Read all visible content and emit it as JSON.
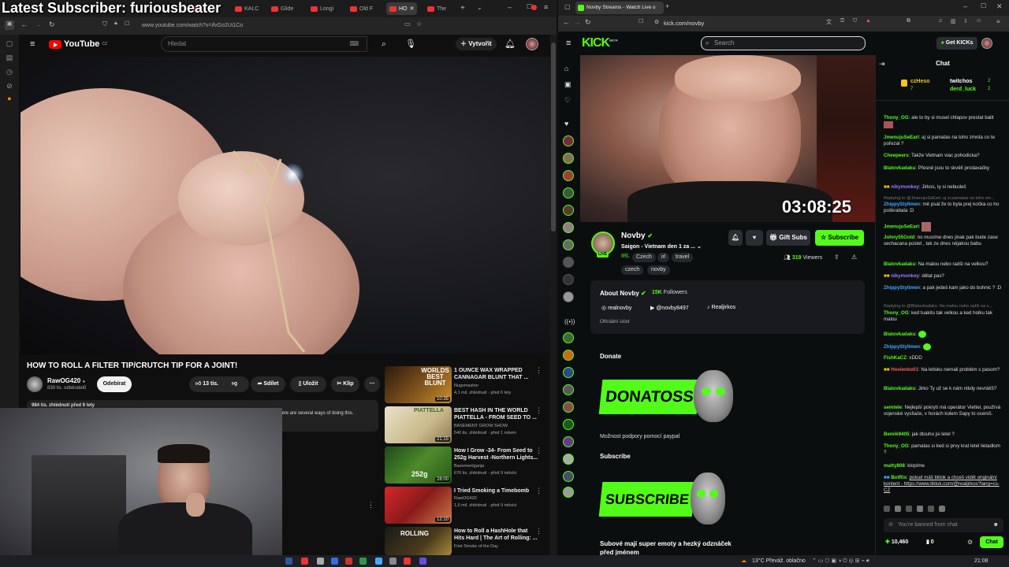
{
  "overlay": {
    "text": "Latest Subscriber: furiousbeater"
  },
  "left_browser": {
    "tabs": [
      {
        "label": "Beaut"
      },
      {
        "label": "KALC"
      },
      {
        "label": "Glide"
      },
      {
        "label": "Longi"
      },
      {
        "label": "Old F"
      },
      {
        "label": "HO"
      },
      {
        "label": "The"
      }
    ],
    "url": "www.youtube.com/watch?v=ifvGo2Ui1Co"
  },
  "youtube": {
    "logo_text": "YouTube",
    "region": "CZ",
    "search_placeholder": "Hledat",
    "create_label": "Vytvořit",
    "video_title": "HOW TO ROLL A FILTER TIP/CRUTCH TIP FOR A JOINT!",
    "channel_name": "RawOG420",
    "subscribers": "839 tis. odběratelů",
    "subscribe_label": "Odebírat",
    "likes": "13 tis.",
    "share_label": "Sdílet",
    "save_label": "Uložit",
    "clip_label": "Klip",
    "description_stats": "984 tis. zhlédnutí  před 9 lety",
    "description_snippet": "here are several ways of doing this.",
    "recommendations": [
      {
        "title": "1 OUNCE WAX WRAPPED CANNAGAR BLUNT THAT ...",
        "channel": "Nugsmasher",
        "meta": "4,1 mil. zhlédnutí · před 6 lety",
        "duration": "10:35",
        "thumb_text": "WORLDS BEST BLUNT"
      },
      {
        "title": "BEST HASH IN THE WORLD PIATTELLA - FROM SEED TO ...",
        "channel": "BASEMENT GROW SHOW",
        "meta": "540 tis. zhlédnutí · před 1 rokem",
        "duration": "21:15",
        "thumb_text": "PIATTELLA"
      },
      {
        "title": "How I Grow -34- From Seed to 252g Harvest -Northern Lights...",
        "channel": "Basementganja",
        "meta": "676 tis. zhlédnutí · před 9 měsíci",
        "duration": "28:00",
        "thumb_text": "252g"
      },
      {
        "title": "I Tried Smoking a Timebomb",
        "channel": "RawOG420",
        "meta": "1,6 mil. zhlédnutí · před 9 měsíci",
        "duration": "12:10",
        "thumb_text": ""
      },
      {
        "title": "How to Roll a HashHole that Hits Hard | The Art of Rolling: ...",
        "channel": "First Smoke of the Day",
        "meta": "",
        "duration": "",
        "thumb_text": "ROLLING"
      }
    ]
  },
  "right_browser": {
    "tab_title": "Novby Streams - Watch Live o",
    "url": "kick.com/novby"
  },
  "kick": {
    "logo": "KICK",
    "logo_badge": "BETA",
    "search_placeholder": "Search",
    "get_kicks_label": "Get KICKs",
    "timer": "03:08:25",
    "streamer": "Novby",
    "live_label": "LIVE",
    "stream_title": "Saigon - Vietnam den 1 za ...",
    "tags": [
      "IRL",
      "Czech",
      "irl",
      "travel",
      "czech",
      "novby"
    ],
    "gift_subs_label": "Gift Subs",
    "subscribe_label": "Subscribe",
    "viewers": "319",
    "viewers_label": "Viewers",
    "about_title": "About Novby",
    "followers_count": "15K",
    "followers_label": "Followers",
    "socials": [
      "realnovby",
      "@novby8497",
      "Realjirkos"
    ],
    "official_account": "Oficiální účet",
    "donate_heading": "Donate",
    "donate_banner": "DONATOSS",
    "donate_caption": "Možnost podpory pomocí paypal",
    "subscribe_heading": "Subscribe",
    "subscribe_banner": "SUBSCRIBE",
    "emote_text": "Subové mají super emoty a hezký odznáček před jménem",
    "accent": "#53fc18"
  },
  "chat": {
    "title": "Chat",
    "leaders": [
      {
        "name": "czHeso",
        "count": "7"
      },
      {
        "name": "twitchos",
        "count": "2"
      },
      {
        "name": "derd_luck",
        "count": "2"
      }
    ],
    "messages": [
      {
        "user": "Thony_OG",
        "text": "ale to by si musel chlapov prestat balit",
        "color": "#53fc18"
      },
      {
        "user": "JmenujuSeEarl",
        "text": "aj si pamatas na toho zmrda co te pořezal ?",
        "color": "#53fc18"
      },
      {
        "user": "Cheepeers",
        "text": "Takže Vietnam viac pohodicka?",
        "color": "#53fc18"
      },
      {
        "user": "Blatovkadaku",
        "text": "Přesně jsou to skvělí prodavačky",
        "color": "#53fc18"
      },
      {
        "user": "nikymonkey",
        "text": "Jirkos, ty si nebudeš",
        "color": "#9b7bff"
      },
      {
        "user": "ZhippyStyllmen",
        "text": "mě psal že to byla prej kočka co ho poškrabala :D",
        "color": "#3fa9ff"
      },
      {
        "user": "JmenujuSeEarl",
        "text": "",
        "color": "#53fc18"
      },
      {
        "user": "Johny55Gold",
        "text": "no musíme dnes jinak pak bude zase sechacana postel , tak ze dnes nějakou babu",
        "color": "#53fc18"
      },
      {
        "user": "Blatovkadaku",
        "text": "Na malou nebo radši na velkou?",
        "color": "#53fc18"
      },
      {
        "user": "nikymonkey",
        "text": "dělat pas?",
        "color": "#9b7bff"
      },
      {
        "user": "ZhippyStyllmen",
        "text": "a pak jedeš kam jako do bohnic ? :D",
        "color": "#3fa9ff"
      },
      {
        "user": "Thony_OG",
        "text": "ked tuakitu tak velkou a ked holku tak malou",
        "color": "#53fc18"
      },
      {
        "user": "Blatovkadaku",
        "text": "",
        "color": "#53fc18"
      },
      {
        "user": "ZhippyStyllmen",
        "text": "",
        "color": "#3fa9ff"
      },
      {
        "user": "FishKaCZ",
        "text": "xDDD",
        "color": "#53fc18"
      },
      {
        "user": "Hovienko01",
        "text": "Na letisku nemali problém s pasom?",
        "color": "#ff5a5a"
      },
      {
        "user": "Blatovkadaku",
        "text": "Jirko Ty už se k nám nikdy nevrátíš?",
        "color": "#53fc18"
      },
      {
        "user": "semtele",
        "text": "Nejlepší pokrytí má operátor Viettel, používá vojenské vysílače, v horách kolem Sapy to oceníš.",
        "color": "#53fc18"
      },
      {
        "user": "Bemik9405",
        "text": "jak dlouho jsi letel ?",
        "color": "#53fc18"
      },
      {
        "user": "Thony_OG",
        "text": "pamatas si ked si prvy krat letel lietadlom ?",
        "color": "#53fc18"
      },
      {
        "user": "matty808",
        "text": "klopíme",
        "color": "#53fc18"
      },
      {
        "user": "BotRix",
        "text": "pokud máš tiktok a chceš vidět originální kontent - https://www.tiktok.com/@realjirkos?lang=cs-CZ",
        "color": "#53fc18"
      }
    ],
    "replies": [
      "Replying to @JmenujuSeEarl: aj si pamatas na toho zm...",
      "Replying to @Blatovkadaku: Na malou nebo radši na v..."
    ],
    "banned_text": "You're banned from chat",
    "points": "10,460",
    "kicks": "0",
    "send_label": "Chat"
  },
  "taskbar": {
    "weather": "13°C  Převáž. oblačno",
    "time": "21:08"
  }
}
